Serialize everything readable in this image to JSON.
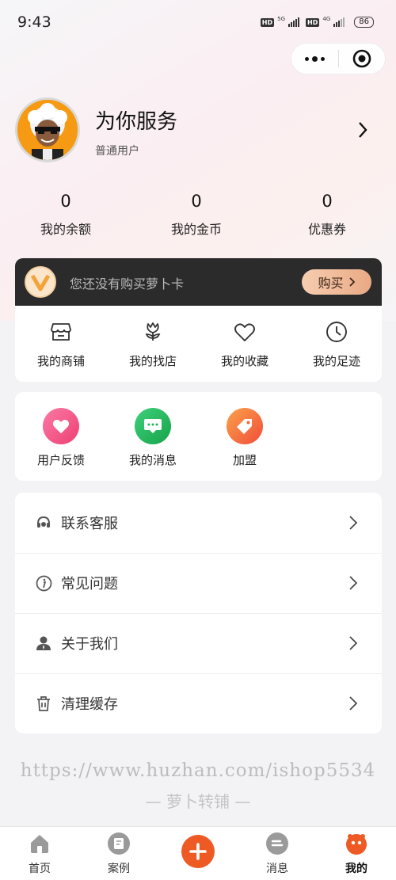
{
  "status_bar": {
    "time": "9:43",
    "hd1": "HD",
    "net1": "5G",
    "hd2": "HD",
    "net2": "4G",
    "battery": "86"
  },
  "profile": {
    "name": "为你服务",
    "level": "普通用户"
  },
  "stats": [
    {
      "value": "0",
      "label": "我的余额"
    },
    {
      "value": "0",
      "label": "我的金币"
    },
    {
      "value": "0",
      "label": "优惠券"
    }
  ],
  "vip": {
    "text": "您还没有购买萝卜卡",
    "button": "购买"
  },
  "quick_links": [
    {
      "label": "我的商铺",
      "icon": "shop-icon"
    },
    {
      "label": "我的找店",
      "icon": "tulip-icon"
    },
    {
      "label": "我的收藏",
      "icon": "heart-icon"
    },
    {
      "label": "我的足迹",
      "icon": "clock-icon"
    }
  ],
  "services": [
    {
      "label": "用户反馈",
      "icon": "feedback-heart-icon",
      "color": "#f2457f"
    },
    {
      "label": "我的消息",
      "icon": "message-icon",
      "color": "#22b55e"
    },
    {
      "label": "加盟",
      "icon": "tag-icon",
      "color": "#f5683b"
    }
  ],
  "menu": [
    {
      "label": "联系客服",
      "icon": "customer-service-icon"
    },
    {
      "label": "常见问题",
      "icon": "info-icon"
    },
    {
      "label": "关于我们",
      "icon": "person-icon"
    },
    {
      "label": "清理缓存",
      "icon": "trash-icon"
    }
  ],
  "watermark": "https://www.huzhan.com/ishop5534",
  "footer_brand": "— 萝卜转铺 —",
  "tabs": [
    {
      "label": "首页",
      "icon": "home-icon"
    },
    {
      "label": "案例",
      "icon": "case-icon"
    },
    {
      "label": "",
      "icon": "add-icon"
    },
    {
      "label": "消息",
      "icon": "chat-icon"
    },
    {
      "label": "我的",
      "icon": "profile-icon",
      "active": true
    }
  ],
  "colors": {
    "accent": "#ee5a24",
    "vip_bg": "#2b2b2b",
    "vip_button": "#e9a985"
  }
}
